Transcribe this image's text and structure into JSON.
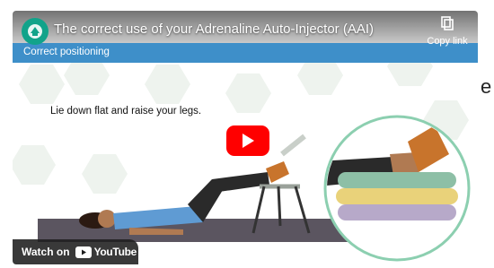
{
  "page": {
    "edge_text": "e"
  },
  "player": {
    "title": "The correct use of your Adrenaline Auto-Injector (AAI)",
    "copy_link_label": "Copy link",
    "section_label": "Correct positioning",
    "instruction": "Lie down flat and raise your legs.",
    "watch_label": "Watch on",
    "youtube_label": "YouTube"
  },
  "icons": {
    "channel": "crest-icon",
    "copy": "copy-icon",
    "play": "play-icon",
    "youtube": "youtube-icon"
  },
  "colors": {
    "play_button": "#ff0000",
    "section_banner": "#3e8fc9",
    "floor": "#5b5560",
    "sock": "#c8742c",
    "trousers": "#2a2a2a",
    "shirt": "#5f9bd3"
  }
}
